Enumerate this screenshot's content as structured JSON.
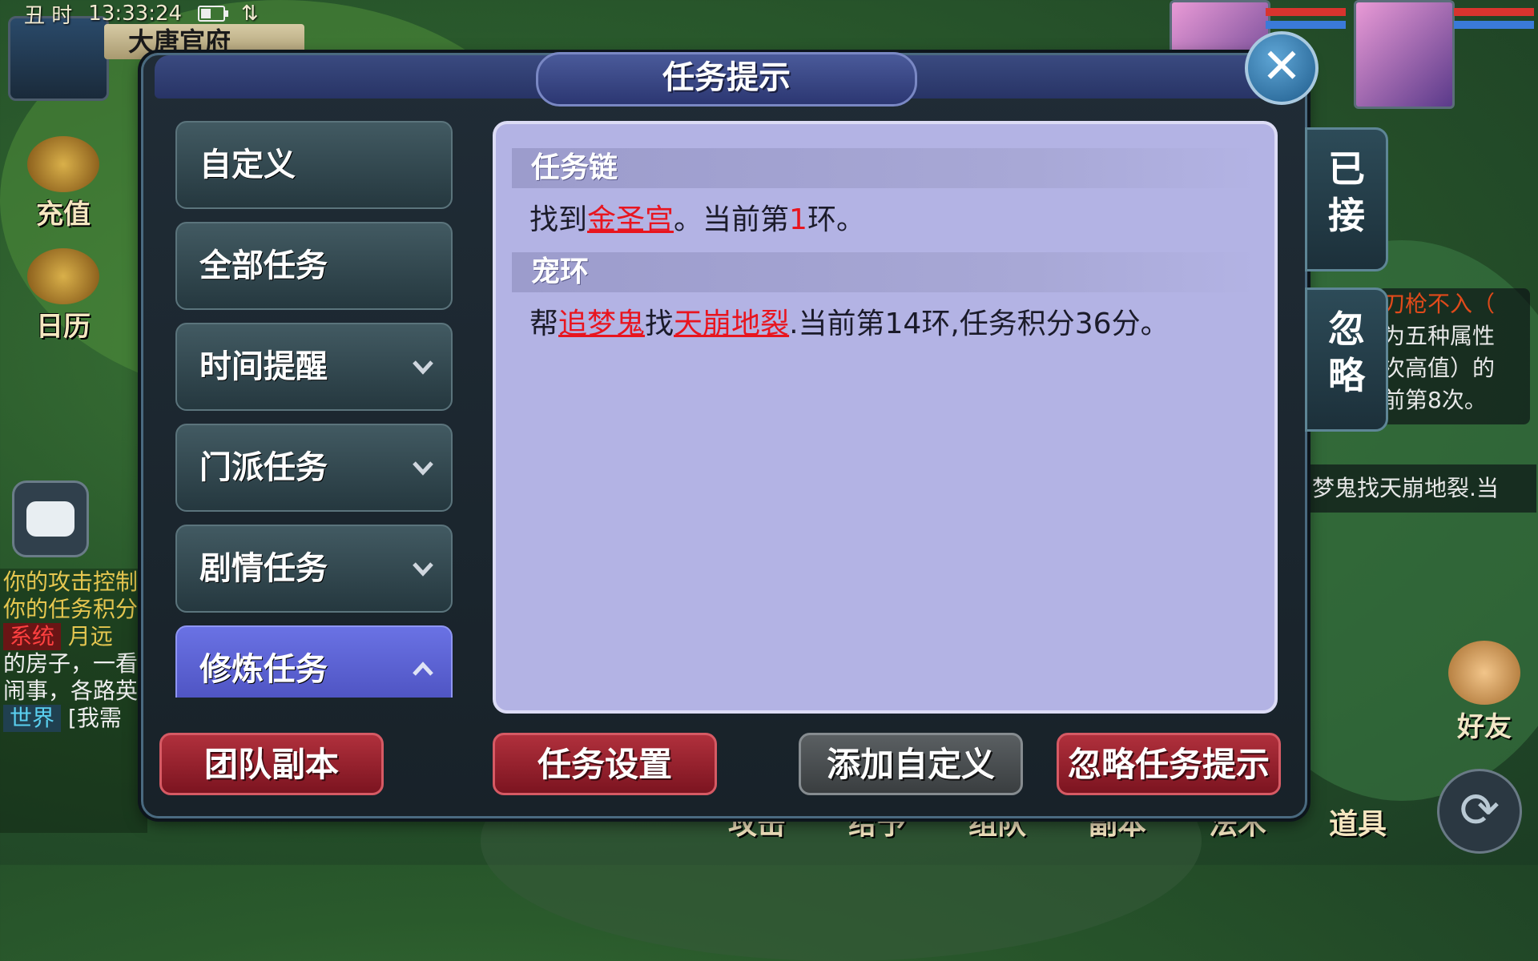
{
  "status_bar": {
    "time_label": "丑 时",
    "clock": "13:33:24"
  },
  "location": "大唐官府",
  "left_hud": [
    {
      "label": "充值",
      "icon": "coin-chest-icon"
    },
    {
      "label": "日历",
      "icon": "compass-calendar-icon"
    }
  ],
  "chat_log": {
    "lines": [
      "你的攻击控制",
      "你的任务积分"
    ],
    "system_tag": "系统",
    "system_text": "月远",
    "white_lines": [
      "的房子，一看",
      "闹事，各路英"
    ],
    "world_tag": "世界",
    "world_text": "[我需"
  },
  "dialog": {
    "title": "任务提示",
    "close_label": "✕",
    "categories": [
      {
        "label": "自定义",
        "chevron": ""
      },
      {
        "label": "全部任务",
        "chevron": ""
      },
      {
        "label": "时间提醒",
        "chevron": "down"
      },
      {
        "label": "门派任务",
        "chevron": "down"
      },
      {
        "label": "剧情任务",
        "chevron": "down"
      },
      {
        "label": "修炼任务",
        "chevron": "up"
      }
    ],
    "tasks": [
      {
        "header": "任务链",
        "prefix": "找到",
        "link1": "金圣宫",
        "mid": "。当前第",
        "num": "1",
        "suffix": "环。"
      },
      {
        "header": "宠环",
        "prefix": "帮",
        "link1": "追梦鬼",
        "mid": "找",
        "link2": "天崩地裂",
        "suffix": ".当前第14环,任务积分36分。"
      }
    ],
    "side_tabs": {
      "accepted": "已接",
      "ignore": "忽略"
    },
    "actions": {
      "team_dungeon": "团队副本",
      "task_settings": "任务设置",
      "add_custom": "添加自定义",
      "ignore_hint": "忽略任务提示"
    }
  },
  "right_panel": {
    "frag_lines": [
      "刀枪不入（",
      "为五种属性",
      "次高值）的",
      "前第8次。"
    ],
    "frag2": "梦鬼找天崩地裂.当",
    "friend": "好友"
  },
  "bottom_bar": [
    "攻击",
    "给予",
    "组队",
    "副本",
    "法术",
    "道具"
  ],
  "colors": {
    "accent_red": "#e8151f",
    "panel_bg": "#b3b3e4",
    "active_tab": "#5a60d8"
  }
}
